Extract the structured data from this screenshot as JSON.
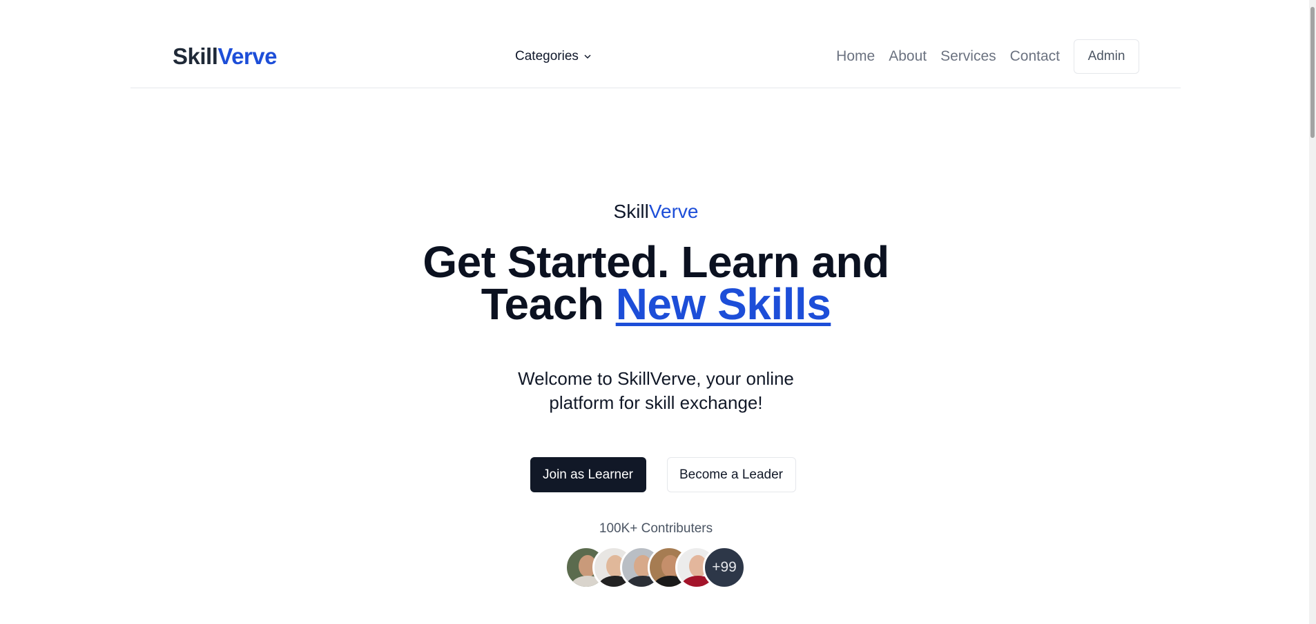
{
  "navbar": {
    "brand_part1": "Skill",
    "brand_part2": "Verve",
    "categories_label": "Categories",
    "links": [
      "Home",
      "About",
      "Services",
      "Contact"
    ],
    "admin_label": "Admin"
  },
  "hero": {
    "brand_part1": "Skill",
    "brand_part2": "Verve",
    "headline_line1": "Get Started. Learn and",
    "headline_line2_prefix": "Teach ",
    "headline_highlight": "New Skills",
    "subtext_line1": "Welcome to SkillVerve, your online",
    "subtext_line2": "platform for skill exchange!",
    "primary_button": "Join as Learner",
    "secondary_button": "Become a Leader",
    "contributors_label": "100K+ Contributers",
    "more_count": "+99"
  },
  "colors": {
    "accent": "#1d4ed8",
    "primary_button": "#111827"
  }
}
